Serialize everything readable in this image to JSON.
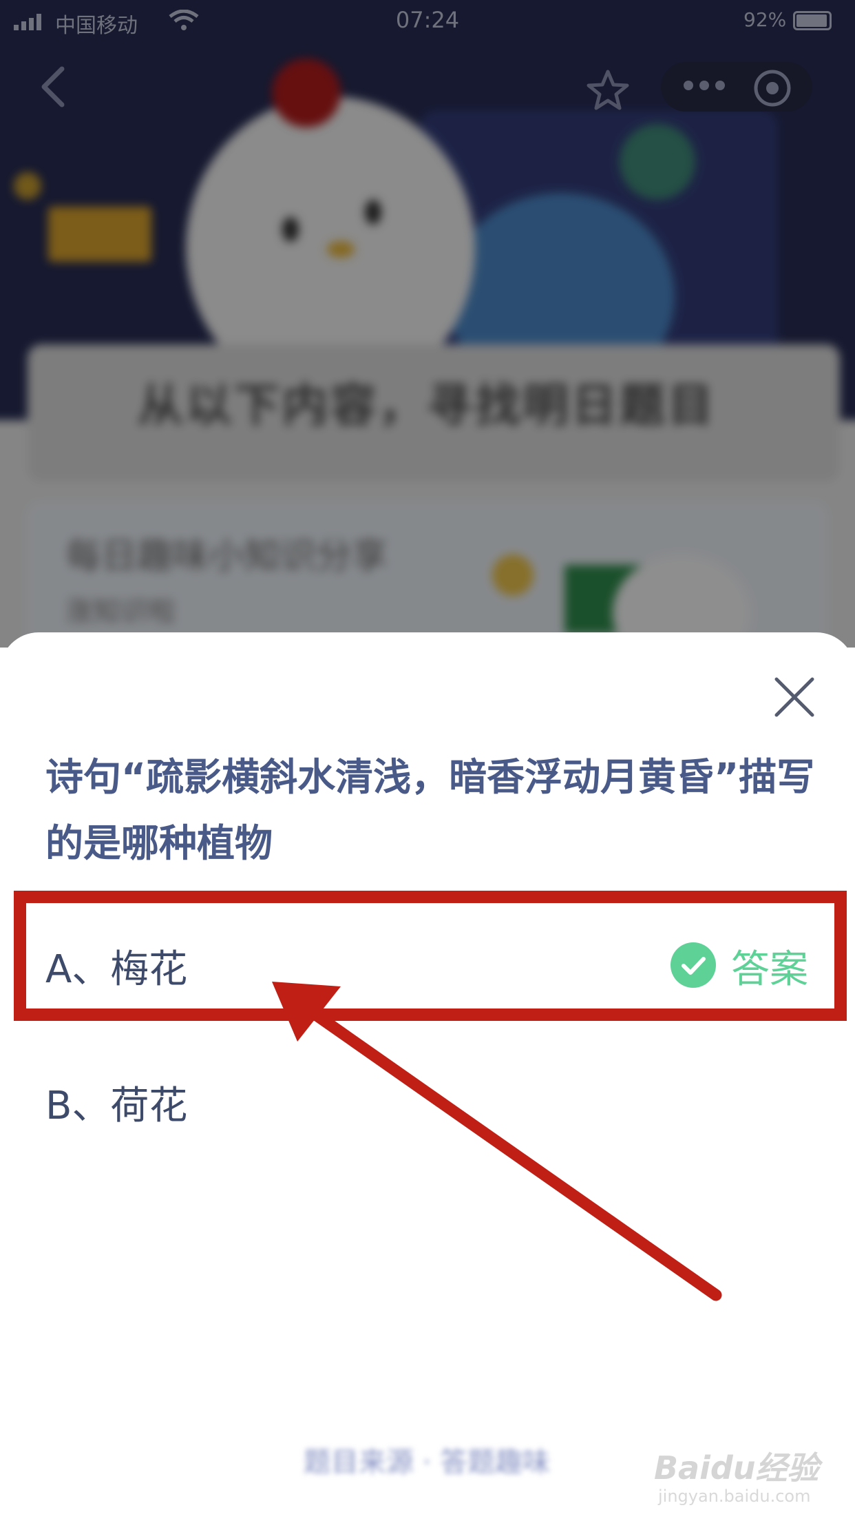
{
  "status_bar": {
    "carrier": "中国移动",
    "time": "07:24",
    "battery": "92%"
  },
  "background": {
    "heading": "从以下内容，寻找明日题目",
    "info_card_title": "每日趣味小知识分享",
    "info_card_subtitle": "涨知识啦"
  },
  "quiz": {
    "question": "诗句“疏影横斜水清浅，暗香浮动月黄昏”描写的是哪种植物",
    "options": [
      {
        "label": "A、梅花",
        "is_answer": true
      },
      {
        "label": "B、荷花",
        "is_answer": false
      }
    ],
    "answer_label": "答案"
  },
  "footer": {
    "button_label": "题目来源 · 答题趣味"
  },
  "watermark": {
    "brand": "Baidu经验",
    "url": "jingyan.baidu.com"
  },
  "colors": {
    "accent_green": "#5ed197",
    "question_text": "#4a5a88",
    "annotation_red": "#c01f16"
  },
  "icons": [
    "back-icon",
    "star-icon",
    "more-icon",
    "target-icon",
    "close-icon",
    "check-icon",
    "signal-icon",
    "wifi-icon",
    "battery-icon"
  ]
}
